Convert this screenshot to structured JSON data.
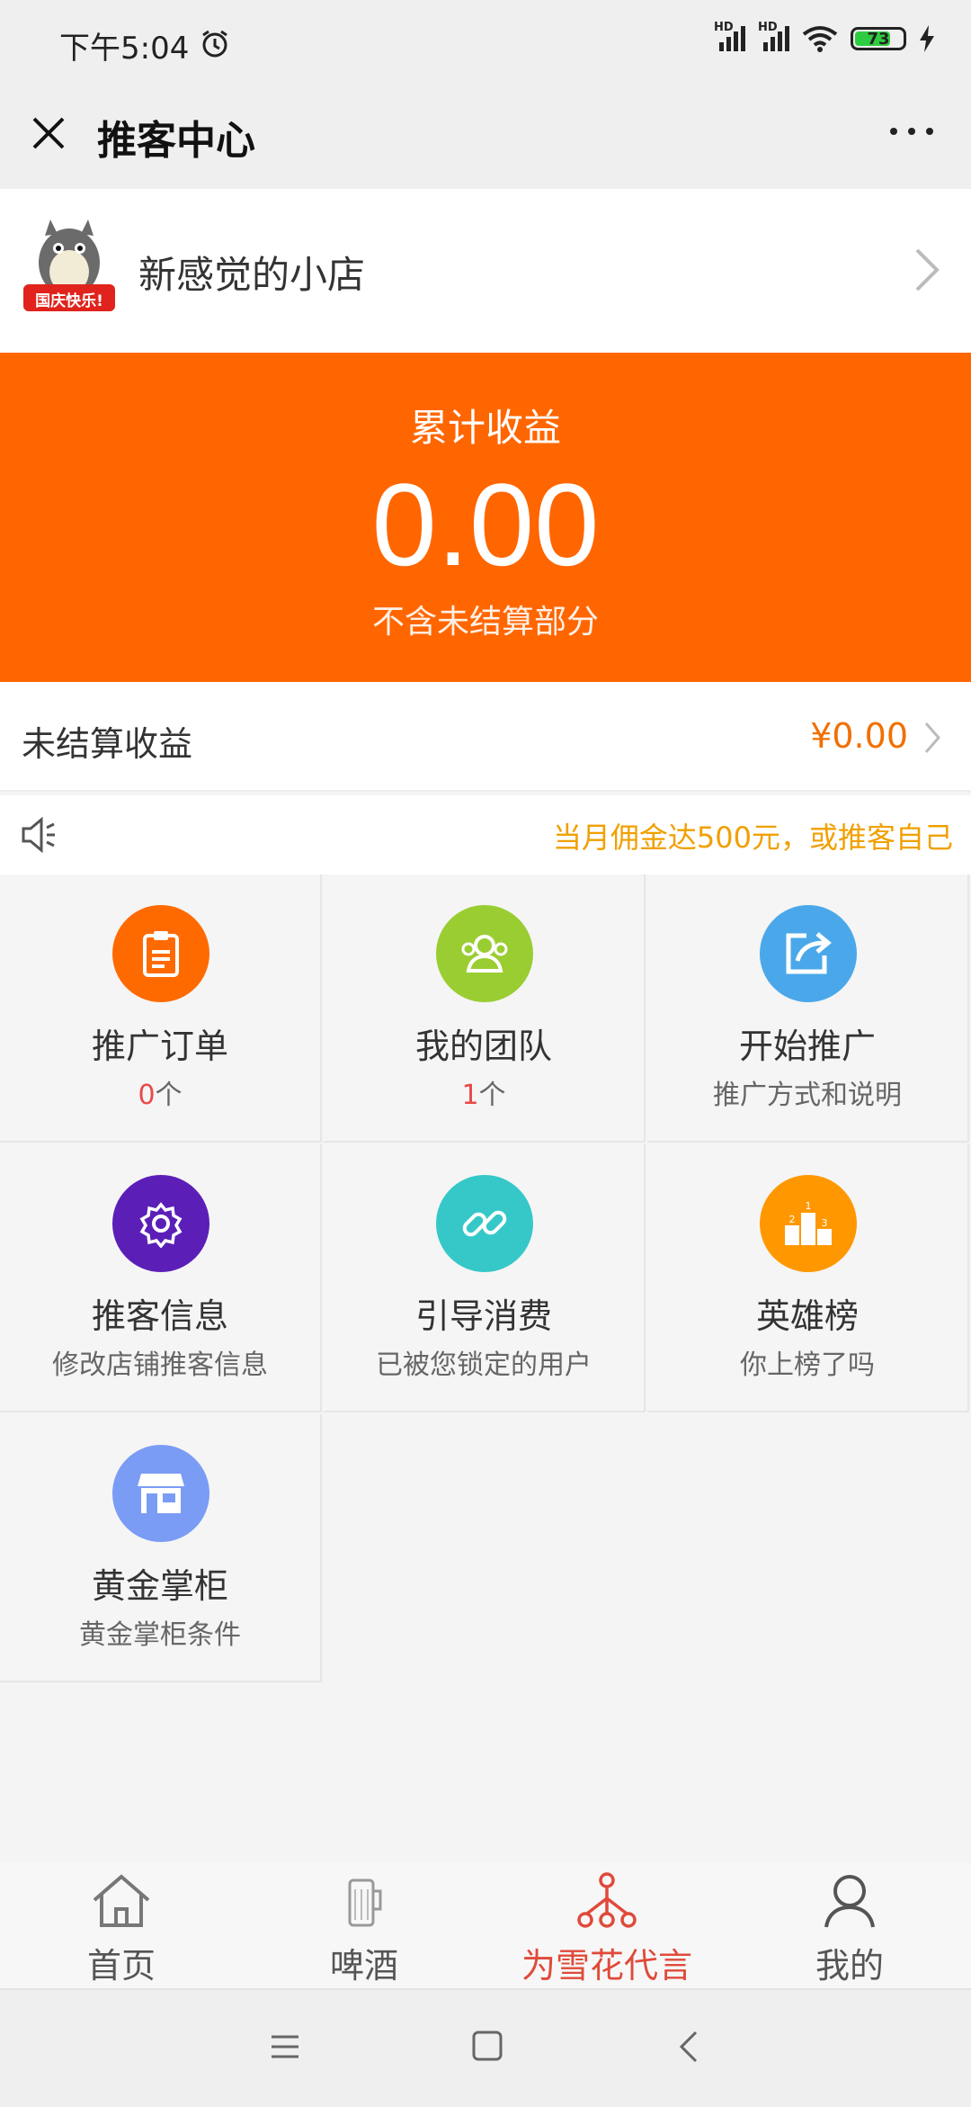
{
  "status_bar": {
    "time": "下午5:04",
    "battery": "73",
    "signal_label": "HD"
  },
  "header": {
    "title": "推客中心"
  },
  "store": {
    "name": "新感觉的小店",
    "avatar_badge": "国庆快乐!"
  },
  "earnings": {
    "label": "累计收益",
    "amount": "0.00",
    "note": "不含未结算部分"
  },
  "unsettled": {
    "label": "未结算收益",
    "value": "¥0.00"
  },
  "notice": {
    "text": "当月佣金达500元，或推客自己"
  },
  "grid": [
    {
      "title": "推广订单",
      "count": "0",
      "unit": "个",
      "icon": "clipboard-icon",
      "color": "#ff6a00"
    },
    {
      "title": "我的团队",
      "count": "1",
      "unit": "个",
      "icon": "team-icon",
      "color": "#9acd32"
    },
    {
      "title": "开始推广",
      "subtitle": "推广方式和说明",
      "icon": "share-icon",
      "color": "#4aa8ea"
    },
    {
      "title": "推客信息",
      "subtitle": "修改店铺推客信息",
      "icon": "gear-icon",
      "color": "#5b1fb8"
    },
    {
      "title": "引导消费",
      "subtitle": "已被您锁定的用户",
      "icon": "link-icon",
      "color": "#36c8c8"
    },
    {
      "title": "英雄榜",
      "subtitle": "你上榜了吗",
      "icon": "podium-icon",
      "color": "#ff9800"
    },
    {
      "title": "黄金掌柜",
      "subtitle": "黄金掌柜条件",
      "icon": "store-icon",
      "color": "#7b9cf5"
    }
  ],
  "bottom_nav": [
    {
      "label": "首页",
      "icon": "home-icon"
    },
    {
      "label": "啤酒",
      "icon": "beer-icon"
    },
    {
      "label": "为雪花代言",
      "icon": "network-icon",
      "active": true
    },
    {
      "label": "我的",
      "icon": "user-icon"
    }
  ],
  "colors": {
    "accent": "#ff6600",
    "active_nav": "#e04a3a",
    "notice": "#f0a000"
  }
}
